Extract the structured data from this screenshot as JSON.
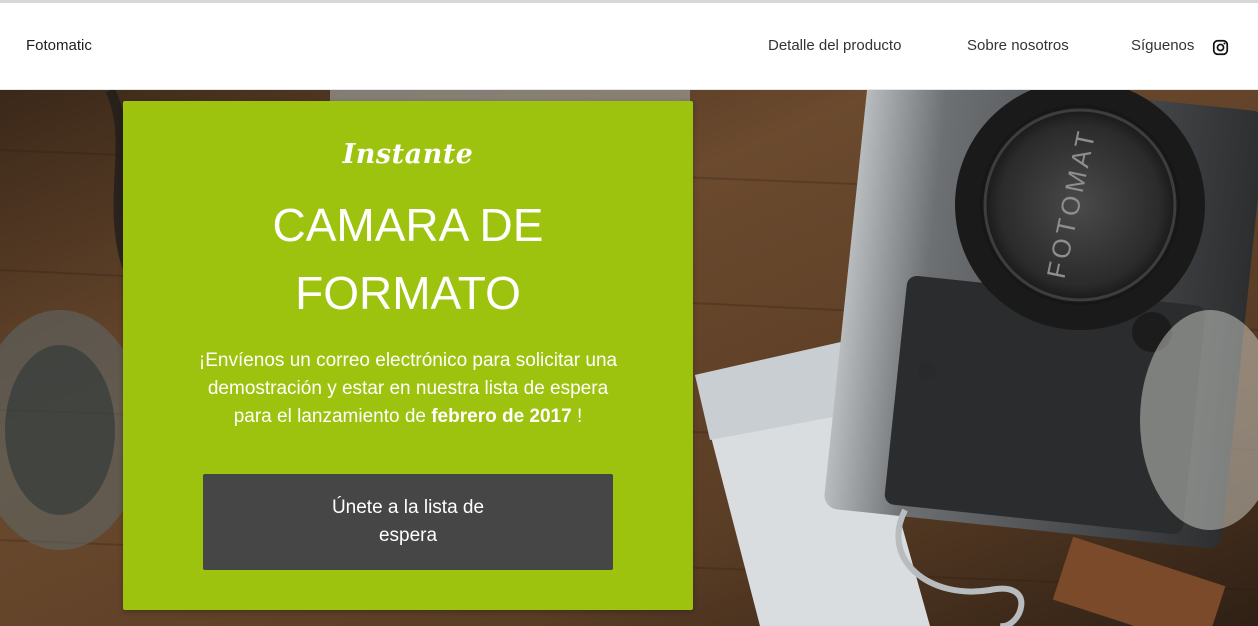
{
  "header": {
    "brand": "Fotomatic",
    "nav": [
      {
        "label": "Detalle del producto"
      },
      {
        "label": "Sobre nosotros"
      },
      {
        "label": "Síguenos"
      }
    ],
    "social_icon": "instagram-icon"
  },
  "hero": {
    "tagline": "Instante",
    "headline_line1": "CAMARA DE",
    "headline_line2": "FORMATO",
    "description_text": "¡Envíenos un correo electrónico para solicitar una demostración y estar en nuestra lista de espera para el lanzamiento de ",
    "description_bold": "febrero de 2017",
    "description_end": " !",
    "cta_label": "Únete a la lista de espera",
    "camera_lens_text": "FOTOMAT",
    "card_color": "#9dc30e",
    "button_color": "#464646"
  }
}
